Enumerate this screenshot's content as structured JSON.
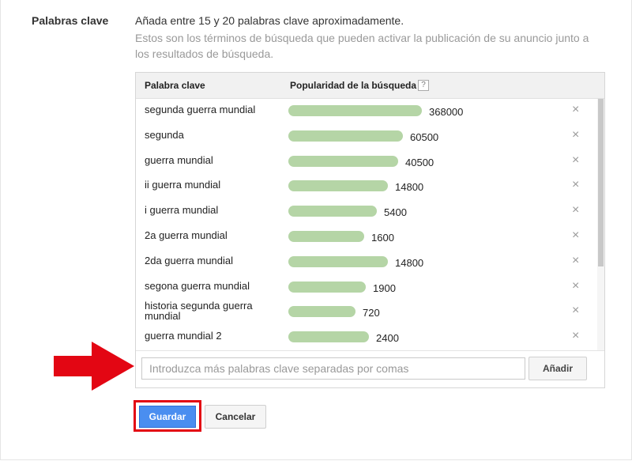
{
  "section": {
    "title": "Palabras clave",
    "intro": "Añada entre 15 y 20 palabras clave aproximadamente.",
    "description": "Estos son los términos de búsqueda que pueden activar la publicación de su anuncio junto a los resultados de búsqueda."
  },
  "table": {
    "header_keyword": "Palabra clave",
    "header_popularity": "Popularidad de la búsqueda",
    "help_icon": "?",
    "max_value": 368000,
    "remove_icon": "×",
    "rows": [
      {
        "keyword": "segunda guerra mundial",
        "popularity": 368000,
        "label": "368000"
      },
      {
        "keyword": "segunda",
        "popularity": 60500,
        "label": "60500"
      },
      {
        "keyword": "guerra mundial",
        "popularity": 40500,
        "label": "40500"
      },
      {
        "keyword": "ii guerra mundial",
        "popularity": 14800,
        "label": "14800"
      },
      {
        "keyword": "i guerra mundial",
        "popularity": 5400,
        "label": "5400"
      },
      {
        "keyword": "2a guerra mundial",
        "popularity": 1600,
        "label": "1600"
      },
      {
        "keyword": "2da guerra mundial",
        "popularity": 14800,
        "label": "14800"
      },
      {
        "keyword": "segona guerra mundial",
        "popularity": 1900,
        "label": "1900"
      },
      {
        "keyword": "historia segunda guerra mundial",
        "popularity": 720,
        "label": "720"
      },
      {
        "keyword": "guerra mundial 2",
        "popularity": 2400,
        "label": "2400"
      }
    ]
  },
  "input": {
    "placeholder": "Introduzca más palabras clave separadas por comas",
    "value": ""
  },
  "buttons": {
    "add": "Añadir",
    "save": "Guardar",
    "cancel": "Cancelar"
  },
  "colors": {
    "bar": "#b5d5a6",
    "save_button": "#4a8ef0",
    "annotation": "#e30613"
  },
  "annotations": {
    "arrow": "red-arrow-icon",
    "highlight": "red-box-around-save"
  }
}
